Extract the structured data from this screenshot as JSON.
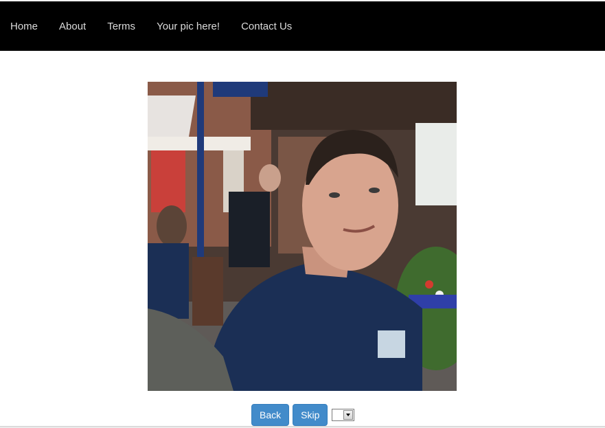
{
  "nav": {
    "items": [
      {
        "label": "Home"
      },
      {
        "label": "About"
      },
      {
        "label": "Terms"
      },
      {
        "label": "Your pic here!"
      },
      {
        "label": "Contact Us"
      }
    ]
  },
  "photo": {
    "colors": {
      "sky": "#e9ece9",
      "building": "#6b4a3b",
      "roof": "#e7e3e0",
      "shirt": "#1b2f55",
      "skin": "#d8a48e",
      "hair": "#2b211c",
      "foliage": "#3f6b2e"
    }
  },
  "controls": {
    "back_label": "Back",
    "skip_label": "Skip",
    "select_value": ""
  },
  "colors": {
    "navbar_bg": "#000000",
    "nav_text": "#dcdcdc",
    "button_bg": "#428bca"
  }
}
